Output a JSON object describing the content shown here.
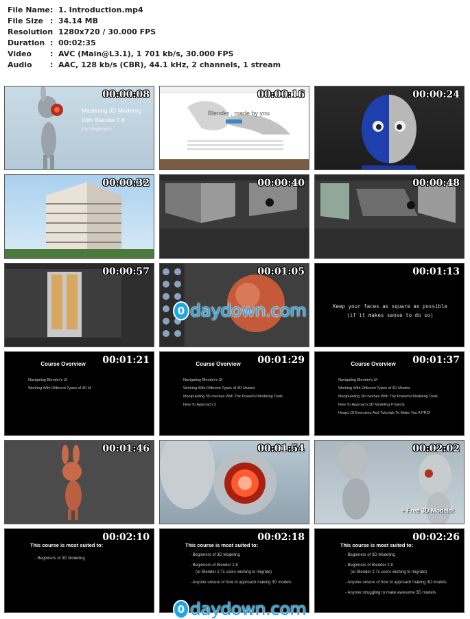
{
  "info": [
    {
      "label": "File Name",
      "value": "1. Introduction.mp4"
    },
    {
      "label": "File Size",
      "value": "34.14 MB"
    },
    {
      "label": "Resolution",
      "value": "1280x720 / 30.000 FPS"
    },
    {
      "label": "Duration",
      "value": "00:02:35"
    },
    {
      "label": "Video",
      "value": "AVC (Main@L3.1), 1 701 kb/s, 30.000 FPS"
    },
    {
      "label": "Audio",
      "value": "AAC, 128 kb/s (CBR), 44.1 kHz, 2 channels, 1 stream"
    }
  ],
  "thumbs": [
    {
      "time": "00:00:08",
      "title": "Mastering 3D Modeling",
      "title2": "With Blender 2.8",
      "sub": "For Beginners"
    },
    {
      "time": "00:00:16",
      "hero": "Blender , made by you"
    },
    {
      "time": "00:00:24"
    },
    {
      "time": "00:00:32"
    },
    {
      "time": "00:00:40"
    },
    {
      "time": "00:00:48"
    },
    {
      "time": "00:00:57"
    },
    {
      "time": "00:01:05"
    },
    {
      "time": "00:01:13",
      "line1": "Keep your faces as square as possible",
      "line2": "(if it makes sense to do so)"
    },
    {
      "time": "00:01:21",
      "heading": "Course Overview",
      "items": [
        "Navigating Blender's UI",
        "Working With Different Types of 3D M"
      ]
    },
    {
      "time": "00:01:29",
      "heading": "Course Overview",
      "items": [
        "Navigating Blender's UI",
        "Working With Different Types of 3D Models",
        "Manipulating 3D meshes With The Powerful Modeling Tools",
        "How To Approach 3"
      ]
    },
    {
      "time": "00:01:37",
      "heading": "Course Overview",
      "items": [
        "Navigating Blender's UI",
        "Working With Different Types of 3D Models",
        "Manipulating 3D meshes With The Powerful Modeling Tools",
        "How To Approach 3D Modeling Projects",
        "Heaps Of Exercises And Tutorials To Make You A PRO!"
      ]
    },
    {
      "time": "00:01:46"
    },
    {
      "time": "00:01:54"
    },
    {
      "time": "00:02:02",
      "caption": "+ Free 3D Models!"
    },
    {
      "time": "00:02:10",
      "heading": "This course is most suited to:",
      "items": [
        "- Beginners of 3D Modeling"
      ]
    },
    {
      "time": "00:02:18",
      "heading": "This course is most suited to:",
      "items": [
        "- Beginners of 3D Modeling",
        "- Beginners of Blender 2.8",
        "(or Blender 2.7x users wishing to migrate)",
        "- Anyone unsure of how to approach making 3D models"
      ]
    },
    {
      "time": "00:02:26",
      "heading": "This course is most suited to:",
      "items": [
        "- Beginners of 3D Modeling",
        "- Beginners of Blender 2.8",
        "(or Blender 2.7x users wishing to migrate)",
        "- Anyone unsure of how to approach making 3D models",
        "- Anyone struggling to make awesome 3D models"
      ]
    }
  ],
  "watermark": {
    "coin": "0",
    "text": "daydown.com"
  }
}
